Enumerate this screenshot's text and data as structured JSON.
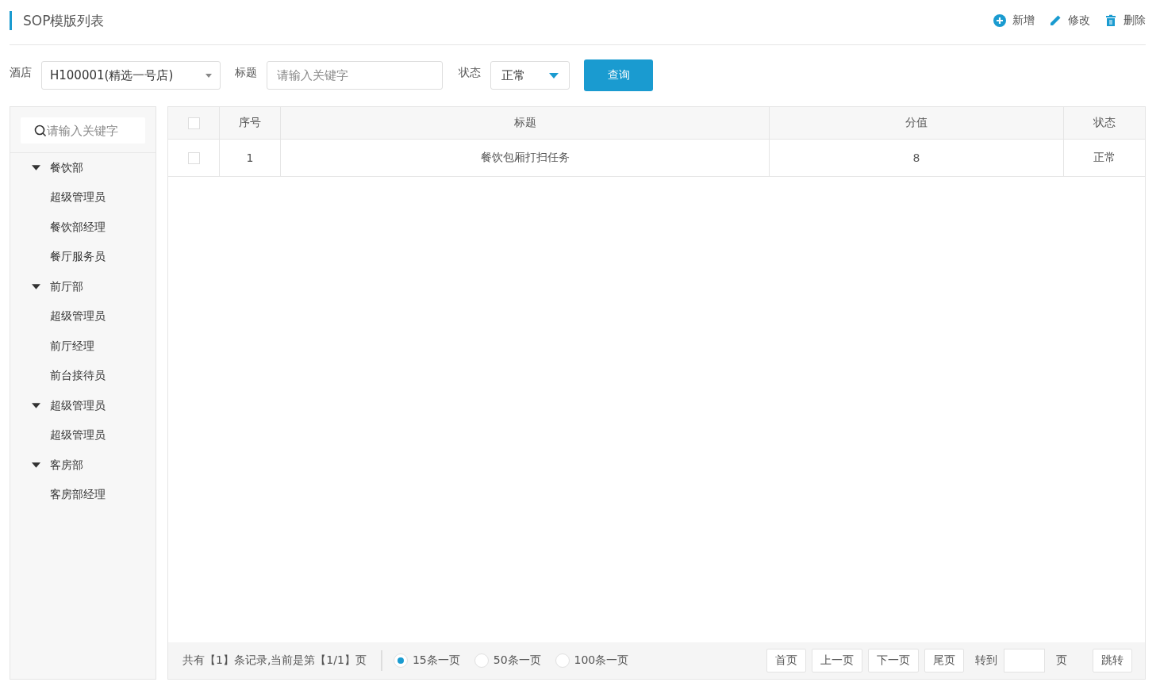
{
  "header": {
    "title": "SOP模版列表",
    "actions": [
      {
        "kind": "add",
        "label": "新增"
      },
      {
        "kind": "edit",
        "label": "修改"
      },
      {
        "kind": "delete",
        "label": "删除"
      }
    ]
  },
  "filters": {
    "hotel_label": "酒店",
    "hotel_value": "H100001(精选一号店)",
    "title_label": "标题",
    "title_placeholder": "请输入关键字",
    "status_label": "状态",
    "status_value": "正常",
    "query_button": "查询"
  },
  "sidebar": {
    "search_placeholder": "请输入关键字",
    "tree": [
      {
        "label": "餐饮部",
        "expanded": true,
        "children": [
          {
            "label": "超级管理员"
          },
          {
            "label": "餐饮部经理"
          },
          {
            "label": "餐厅服务员"
          }
        ]
      },
      {
        "label": "前厅部",
        "expanded": true,
        "children": [
          {
            "label": "超级管理员"
          },
          {
            "label": "前厅经理"
          },
          {
            "label": "前台接待员"
          }
        ]
      },
      {
        "label": "超级管理员",
        "expanded": true,
        "children": [
          {
            "label": "超级管理员"
          }
        ]
      },
      {
        "label": "客房部",
        "expanded": true,
        "children": [
          {
            "label": "客房部经理"
          }
        ]
      }
    ]
  },
  "table": {
    "select_all_checked": false,
    "columns": [
      "序号",
      "标题",
      "分值",
      "状态"
    ],
    "rows": [
      {
        "checked": false,
        "cells": [
          "1",
          "餐饮包厢打扫任务",
          "8",
          "正常"
        ]
      }
    ]
  },
  "pagination": {
    "summary": "共有【1】条记录,当前是第【1/1】页",
    "page_sizes": [
      {
        "label": "15条一页",
        "selected": true
      },
      {
        "label": "50条一页",
        "selected": false
      },
      {
        "label": "100条一页",
        "selected": false
      }
    ],
    "buttons": [
      "首页",
      "上一页",
      "下一页",
      "尾页"
    ],
    "goto_label": "转到",
    "goto_suffix": "页",
    "jump_button": "跳转"
  }
}
